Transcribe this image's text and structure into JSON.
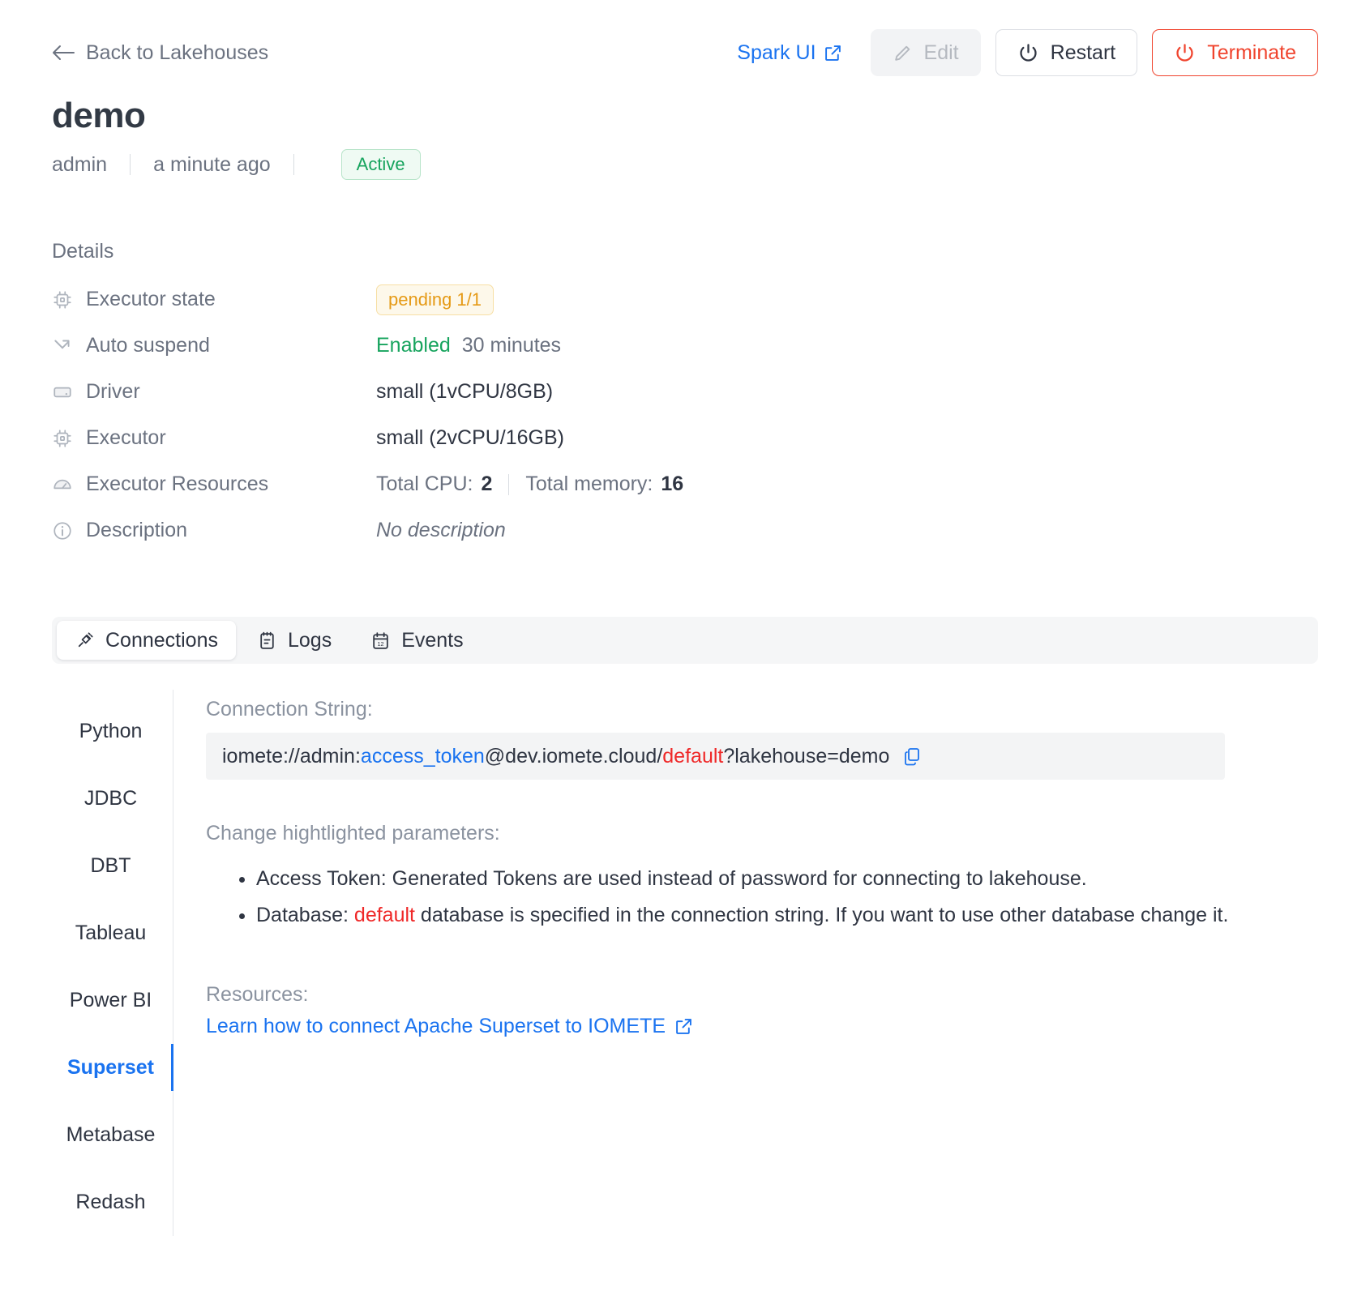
{
  "topbar": {
    "back_label": "Back to Lakehouses",
    "back_icon": "arrow-left-icon",
    "spark_ui_label": "Spark UI",
    "external_link_icon": "external-link-icon",
    "edit_label": "Edit",
    "edit_icon": "pencil-icon",
    "restart_label": "Restart",
    "restart_icon": "power-icon",
    "terminate_label": "Terminate",
    "terminate_icon": "power-icon",
    "accent_blue": "#1a73f0",
    "danger_red": "#f0442e"
  },
  "header": {
    "title": "demo",
    "owner": "admin",
    "updated": "a minute ago",
    "status": "Active",
    "status_color": "#17a45e"
  },
  "details": {
    "heading": "Details",
    "rows": [
      {
        "icon": "cpu-icon",
        "label": "Executor state",
        "value": "pending 1/1",
        "kind": "badge-warning"
      },
      {
        "icon": "auto-suspend-icon",
        "label": "Auto suspend",
        "value": "Enabled",
        "value2": "30 minutes",
        "kind": "enabled"
      },
      {
        "icon": "driver-icon",
        "label": "Driver",
        "value": "small (1vCPU/8GB)",
        "kind": "text"
      },
      {
        "icon": "cpu-icon",
        "label": "Executor",
        "value": "small (2vCPU/16GB)",
        "kind": "text"
      },
      {
        "icon": "gauge-icon",
        "label": "Executor Resources",
        "value": "Total CPU:",
        "value_num": "2",
        "value2": "Total memory:",
        "value2_num": "16",
        "kind": "resources"
      },
      {
        "icon": "info-icon",
        "label": "Description",
        "value": "No description",
        "kind": "italic"
      }
    ]
  },
  "tabs": [
    {
      "label": "Connections",
      "icon": "plug-icon",
      "active": true
    },
    {
      "label": "Logs",
      "icon": "notepad-icon",
      "active": false
    },
    {
      "label": "Events",
      "icon": "calendar-icon",
      "active": false
    }
  ],
  "connections": {
    "sidebar": [
      {
        "label": "Python",
        "active": false
      },
      {
        "label": "JDBC",
        "active": false
      },
      {
        "label": "DBT",
        "active": false
      },
      {
        "label": "Tableau",
        "active": false
      },
      {
        "label": "Power BI",
        "active": false
      },
      {
        "label": "Superset",
        "active": true
      },
      {
        "label": "Metabase",
        "active": false
      },
      {
        "label": "Redash",
        "active": false
      }
    ],
    "connection_string_label": "Connection String:",
    "connection_string": {
      "prefix": "iomete://admin:",
      "token": "access_token",
      "middle": "@dev.iomete.cloud/",
      "database": "default",
      "suffix": "?lakehouse=demo",
      "full": "iomete://admin:access_token@dev.iomete.cloud/default?lakehouse=demo",
      "token_color": "#1a73f0",
      "database_color": "#ef2828",
      "copy_icon": "copy-icon"
    },
    "change_params_label": "Change hightlighted parameters:",
    "params": [
      "Access Token: Generated Tokens are used instead of password for connecting to lakehouse.",
      "Database: default database is specified in the connection string. If you want to use other database change it."
    ],
    "param2": {
      "prefix": "Database: ",
      "highlight": "default",
      "rest": " database is specified in the connection string. If you want to use other database change it."
    },
    "resources_label": "Resources:",
    "resource_link": "Learn how to connect Apache Superset to IOMETE"
  }
}
